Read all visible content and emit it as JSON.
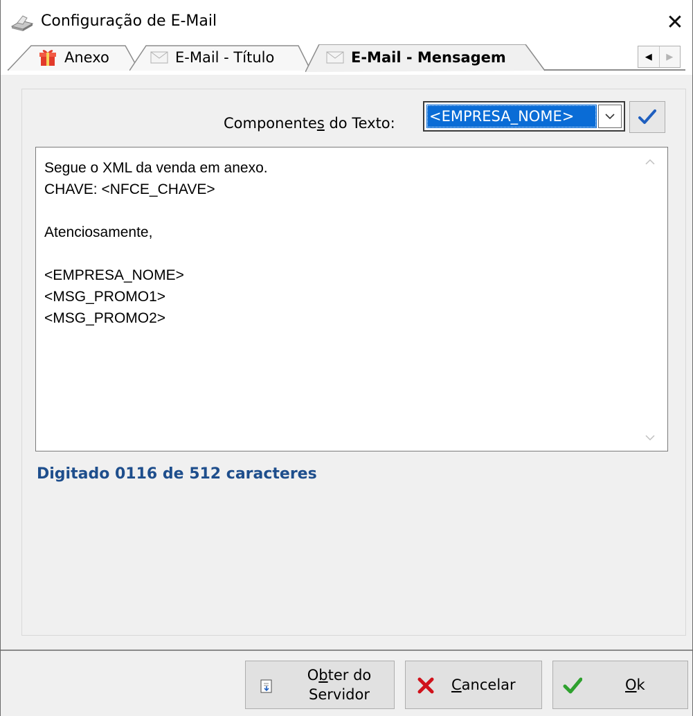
{
  "window": {
    "title": "Configuração de E-Mail",
    "close_glyph": "✕"
  },
  "tabs": [
    {
      "label": "Anexo",
      "icon": "gift-icon",
      "active": false
    },
    {
      "label": "E-Mail - Título",
      "icon": "envelope-icon",
      "active": false
    },
    {
      "label": "E-Mail - Mensagem",
      "icon": "envelope-icon",
      "active": true
    }
  ],
  "tab_scroll": {
    "left": "◀",
    "right": "▶"
  },
  "components": {
    "label_pre": "Componente",
    "label_ul": "s",
    "label_post": " do Texto:",
    "selected": "<EMPRESA_NOME>"
  },
  "message": {
    "text": "Segue o XML da venda em anexo.\nCHAVE: <NFCE_CHAVE>\n\nAtenciosamente,\n\n<EMPRESA_NOME>\n<MSG_PROMO1>\n<MSG_PROMO2>"
  },
  "counter": "Digitado 0116 de 512 caracteres",
  "buttons": {
    "obter_line1_pre": "O",
    "obter_line1_ul": "b",
    "obter_line1_post": "ter do",
    "obter_line2": "Servidor",
    "cancelar_ul": "C",
    "cancelar_rest": "ancelar",
    "ok_ul": "O",
    "ok_rest": "k"
  },
  "colors": {
    "selection_blue": "#0a6cd6",
    "counter_blue": "#1e4e8c",
    "check_blue": "#1f5fbf",
    "cancel_red": "#d0121b",
    "ok_green": "#2ea12e"
  }
}
